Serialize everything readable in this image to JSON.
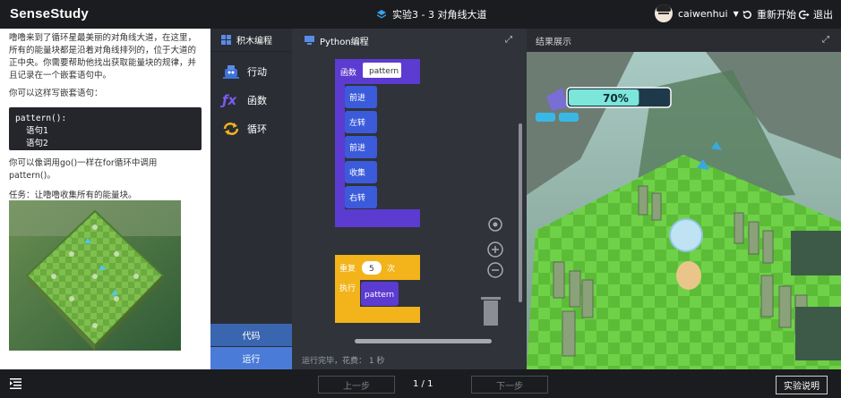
{
  "app": {
    "logo": "SenseStudy",
    "title": "实验3 - 3  对角线大道"
  },
  "user": {
    "name": "caiwenhui"
  },
  "top_actions": {
    "restart": "重新开始",
    "exit": "退出"
  },
  "instructions": {
    "p1": "噜噜来到了循环星最美丽的对角线大道，在这里，所有的能量块都是沿着对角线排列的，位于大道的正中央。你需要帮助他找出获取能量块的规律，并且记录在一个嵌套语句中。",
    "p2": "你可以这样写嵌套语句：",
    "code": {
      "l1": "pattern():",
      "l2": "语句1",
      "l3": "语句2"
    },
    "p3": "你可以像调用go()一样在for循环中调用pattern()。",
    "p4": "任务：让噜噜收集所有的能量块。"
  },
  "palette": {
    "header": "积木编程",
    "items": [
      {
        "label": "行动"
      },
      {
        "label": "函数"
      },
      {
        "label": "循环"
      }
    ],
    "code_btn": "代码",
    "run_btn": "运行"
  },
  "workspace": {
    "header": "Python编程",
    "func_label": "函数",
    "func_name": "pattern",
    "statements": [
      "前进",
      "左转",
      "前进",
      "收集",
      "右转"
    ],
    "repeat_label": "重复",
    "repeat_count": "5",
    "repeat_unit": "次",
    "exec_label": "执行",
    "call_name": "pattern",
    "status": "运行完毕，花费： 1 秒"
  },
  "result": {
    "header": "结果展示",
    "progress_text": "70%",
    "progress": 0.7
  },
  "footer": {
    "prev": "上一步",
    "page": "1 / 1",
    "next": "下一步",
    "help": "实验说明"
  },
  "colors": {
    "func_purple": "#5b3bd0",
    "stmt_blue": "#3b5bdb",
    "loop_yellow": "#f2b31b",
    "run_blue": "#4a7bd8",
    "code_blue": "#3a66b0"
  }
}
